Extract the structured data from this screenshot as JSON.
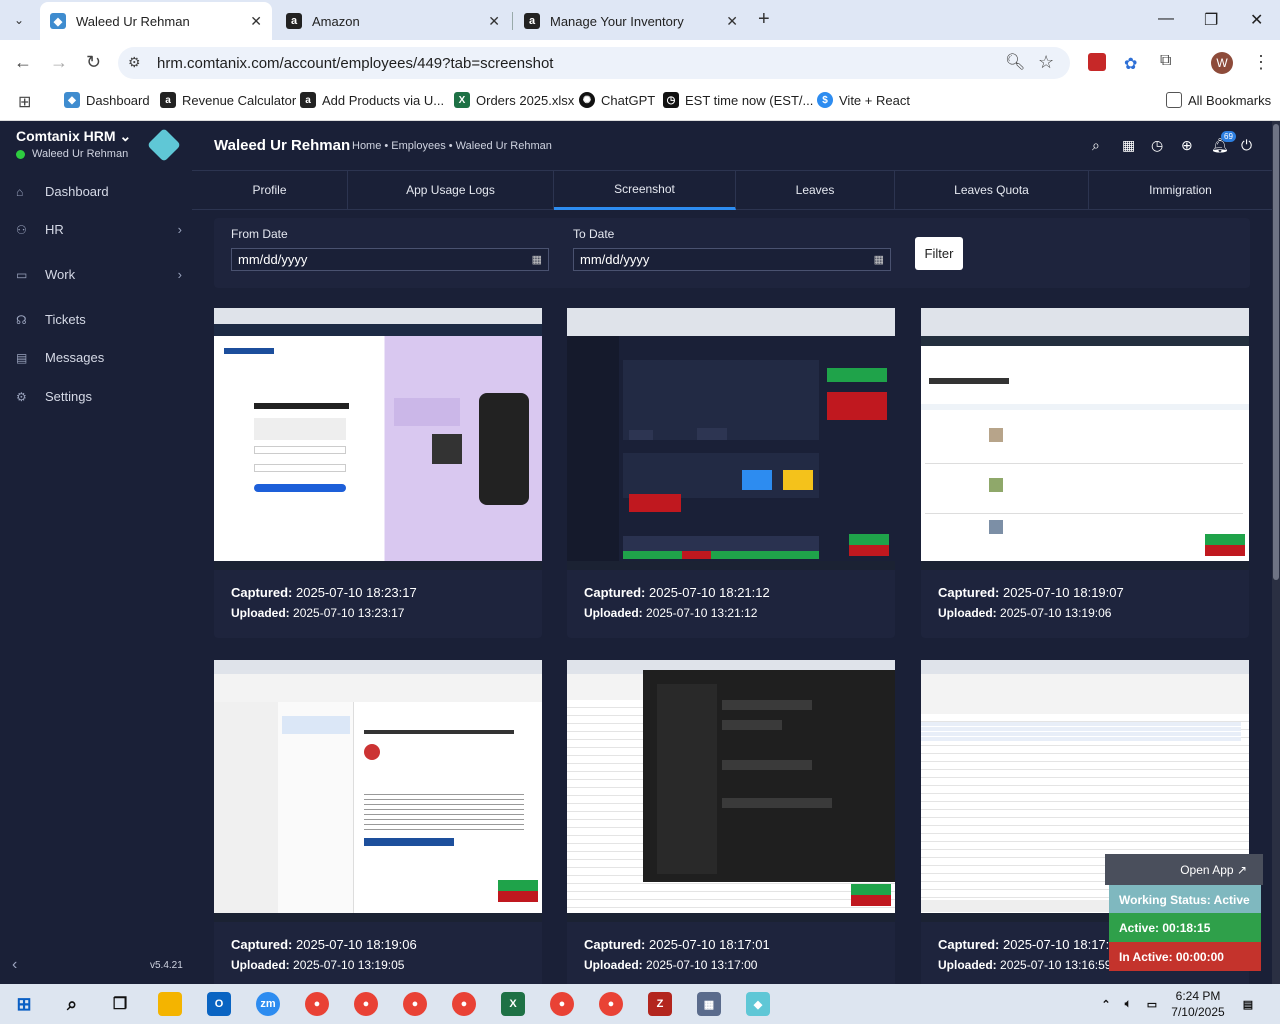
{
  "browser": {
    "tabs": [
      {
        "title": "Waleed Ur Rehman",
        "icon": "app-hex-icon",
        "active": true
      },
      {
        "title": "Amazon",
        "icon": "amazon-icon",
        "active": false
      },
      {
        "title": "Manage Your Inventory",
        "icon": "amazon-icon",
        "active": false
      }
    ],
    "url": "hrm.comtanix.com/account/employees/449?tab=screenshot",
    "bookmarks": [
      {
        "label": "Dashboard",
        "icon": "hex-icon",
        "color": "#3f8ccf"
      },
      {
        "label": "Revenue Calculator",
        "icon": "amazon-icon",
        "color": "#222"
      },
      {
        "label": "Add Products via U...",
        "icon": "amazon-icon",
        "color": "#222"
      },
      {
        "label": "Orders 2025.xlsx",
        "icon": "excel-icon",
        "color": "#1e7145"
      },
      {
        "label": "ChatGPT",
        "icon": "chatgpt-icon",
        "color": "#111"
      },
      {
        "label": "EST time now (EST/...",
        "icon": "clock-icon",
        "color": "#111"
      },
      {
        "label": "Vite + React",
        "icon": "dollar-icon",
        "color": "#2d8cf0"
      }
    ],
    "all_bookmarks": "All Bookmarks",
    "profile_initial": "W"
  },
  "sidebar": {
    "brand": "Comtanix HRM",
    "user": "Waleed Ur Rehman",
    "items": [
      {
        "label": "Dashboard",
        "icon": "home-icon",
        "has_children": false
      },
      {
        "label": "HR",
        "icon": "users-icon",
        "has_children": true
      },
      {
        "label": "Work",
        "icon": "briefcase-icon",
        "has_children": true
      },
      {
        "label": "Tickets",
        "icon": "headset-icon",
        "has_children": false
      },
      {
        "label": "Messages",
        "icon": "message-icon",
        "has_children": false
      },
      {
        "label": "Settings",
        "icon": "gear-icon",
        "has_children": false
      }
    ],
    "version": "v5.4.21"
  },
  "header": {
    "title": "Waleed Ur Rehman",
    "breadcrumb": "Home • Employees • Waleed Ur Rehman",
    "notification_count": "69"
  },
  "profile_tabs": [
    {
      "label": "Profile",
      "active": false
    },
    {
      "label": "App Usage Logs",
      "active": false
    },
    {
      "label": "Screenshot",
      "active": true
    },
    {
      "label": "Leaves",
      "active": false
    },
    {
      "label": "Leaves Quota",
      "active": false
    },
    {
      "label": "Immigration",
      "active": false
    }
  ],
  "filter": {
    "from_label": "From Date",
    "from_placeholder": "mm/dd/yyyy",
    "to_label": "To Date",
    "to_placeholder": "mm/dd/yyyy",
    "button": "Filter"
  },
  "screenshots": [
    {
      "captured": "2025-07-10 18:23:17",
      "uploaded": "2025-07-10 13:23:17",
      "theme": "login"
    },
    {
      "captured": "2025-07-10 18:21:12",
      "uploaded": "2025-07-10 13:21:12",
      "theme": "dark"
    },
    {
      "captured": "2025-07-10 18:19:07",
      "uploaded": "2025-07-10 13:19:06",
      "theme": "inventory"
    },
    {
      "captured": "2025-07-10 18:19:06",
      "uploaded": "2025-07-10 13:19:05",
      "theme": "outlook"
    },
    {
      "captured": "2025-07-10 18:17:01",
      "uploaded": "2025-07-10 13:17:00",
      "theme": "teams"
    },
    {
      "captured": "2025-07-10 18:17:00",
      "uploaded": "2025-07-10 13:16:59",
      "theme": "excel"
    }
  ],
  "labels": {
    "captured": "Captured:",
    "uploaded": "Uploaded:"
  },
  "work_status": {
    "open_app": "Open App",
    "status": "Working Status: Active",
    "active": "Active: 00:18:15",
    "inactive": "In Active: 00:00:00"
  },
  "taskbar": {
    "time": "6:24 PM",
    "date": "7/10/2025"
  }
}
